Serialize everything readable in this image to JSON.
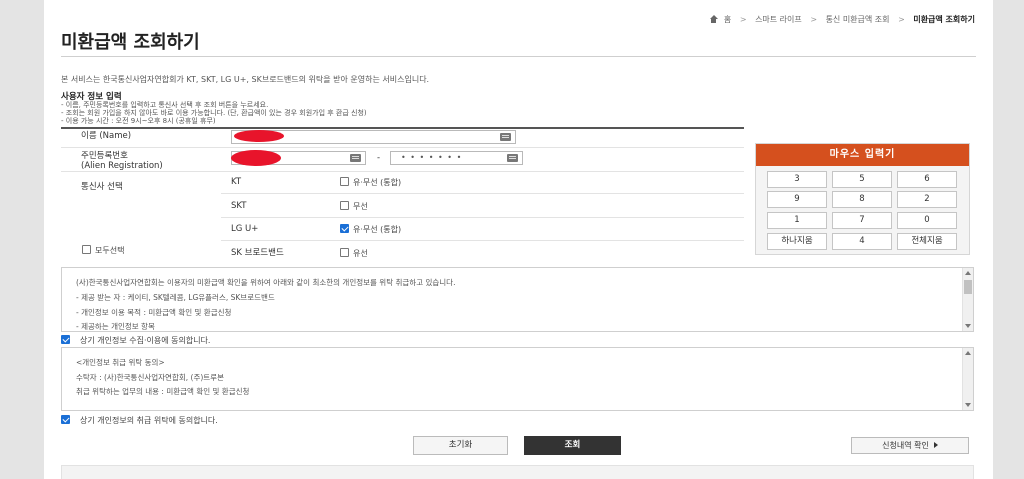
{
  "breadcrumb": {
    "items": [
      "홈",
      "스마트 라이프",
      "통신 미환급액 조회"
    ],
    "current": "미환급액 조회하기"
  },
  "page_title": "미환급액 조회하기",
  "service_desc": "본 서비스는 한국통신사업자연합회가 KT, SKT, LG U+, SK브로드밴드의 위탁을 받아 운영하는 서비스입니다.",
  "user_info": {
    "title": "사용자 정보 입력",
    "notes": [
      "- 이름, 주민등록번호를 입력하고 통신사 선택 후 조회 버튼을 누르세요.",
      "- 조회는 회원 가입을 하지 않아도 바로 이용 가능합니다. (단, 환급액이 있는 경우 회원가입 후 환급 신청)",
      "- 이용 가능 시간 : 오전 9시~오후 8시 (공휴일 휴무)"
    ]
  },
  "form": {
    "name_label": "이름 (Name)",
    "rrn_label_1": "주민등록번호",
    "rrn_label_2": "(Alien Registration)",
    "rrn_dash": "-",
    "rrn_back_value": "• • • • • • •",
    "carrier_label": "통신사 선택",
    "select_all_label": "모두선택",
    "carriers": [
      {
        "name": "KT",
        "option": "유·무선 (통합)",
        "checked": false
      },
      {
        "name": "SKT",
        "option": "무선",
        "checked": false
      },
      {
        "name": "LG U+",
        "option": "유·무선 (통합)",
        "checked": true
      },
      {
        "name": "SK 브로드밴드",
        "option": "유선",
        "checked": false
      }
    ]
  },
  "mouse_keypad": {
    "title": "마우스 입력기",
    "keys": [
      "3",
      "5",
      "6",
      "9",
      "8",
      "2",
      "1",
      "7",
      "0",
      "하나지움",
      "4",
      "전체지움"
    ]
  },
  "consent_box_1": {
    "lines": [
      "(사)한국통신사업자연합회는 이용자의 미환급액 확인을 위하여 아래와 같이 최소한의 개인정보를 위탁 취급하고 있습니다.",
      "- 제공 받는 자 : 케이티, SK텔레콤, LG유플러스, SK브로드밴드",
      "- 개인정보 이용 목적 : 미환급액 확인 및 환급신청",
      "- 제공하는 개인정보 항목"
    ]
  },
  "agree_1": {
    "label": "상기 개인정보 수집·이용에 동의합니다.",
    "checked": true
  },
  "consent_box_2": {
    "lines": [
      "<개인정보 취급 위탁 동의>",
      "수탁자 : (사)한국통신사업자연합회, (주)트루본",
      "취급 위탁하는 업무의 내용 : 미환급액 확인 및 환급신청"
    ]
  },
  "agree_2": {
    "label": "상기 개인정보의 취급 위탁에 동의합니다.",
    "checked": true
  },
  "buttons": {
    "reset": "초기화",
    "search": "조회",
    "history": "신청내역 확인"
  },
  "colors": {
    "keypad_header": "#d5501e",
    "checkbox_on": "#1a6fd6",
    "search_button": "#333333"
  }
}
